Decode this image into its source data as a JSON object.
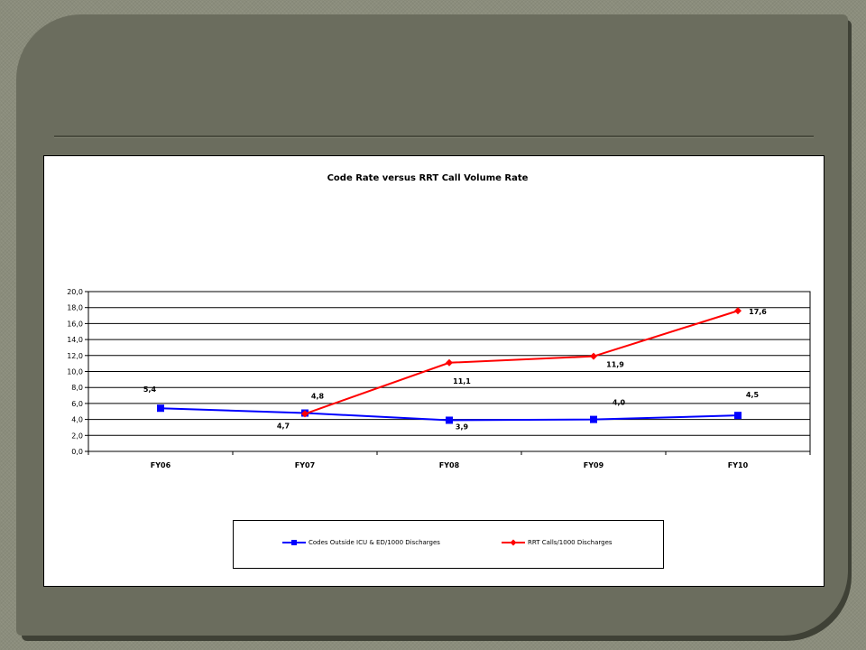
{
  "chart_data": {
    "type": "line",
    "title": "Code Rate versus RRT Call Volume Rate",
    "categories": [
      "FY06",
      "FY07",
      "FY08",
      "FY09",
      "FY10"
    ],
    "ylim": [
      0,
      20
    ],
    "yticks": [
      "0,0",
      "2,0",
      "4,0",
      "6,0",
      "8,0",
      "10,0",
      "12,0",
      "14,0",
      "16,0",
      "18,0",
      "20,0"
    ],
    "grid": true,
    "legend_position": "bottom",
    "series": [
      {
        "name": "Codes Outside ICU & ED/1000 Discharges",
        "color": "#0000ff",
        "marker": "square",
        "values": [
          5.4,
          4.8,
          3.9,
          4.0,
          4.5
        ],
        "labels": [
          "5,4",
          "4,8",
          "3,9",
          "4,0",
          "4,5"
        ]
      },
      {
        "name": "RRT Calls/1000 Discharges",
        "color": "#ff0000",
        "marker": "diamond",
        "values": [
          null,
          4.7,
          11.1,
          11.9,
          17.6
        ],
        "labels": [
          "",
          "4,7",
          "11,1",
          "11,9",
          "17,6"
        ]
      }
    ]
  }
}
